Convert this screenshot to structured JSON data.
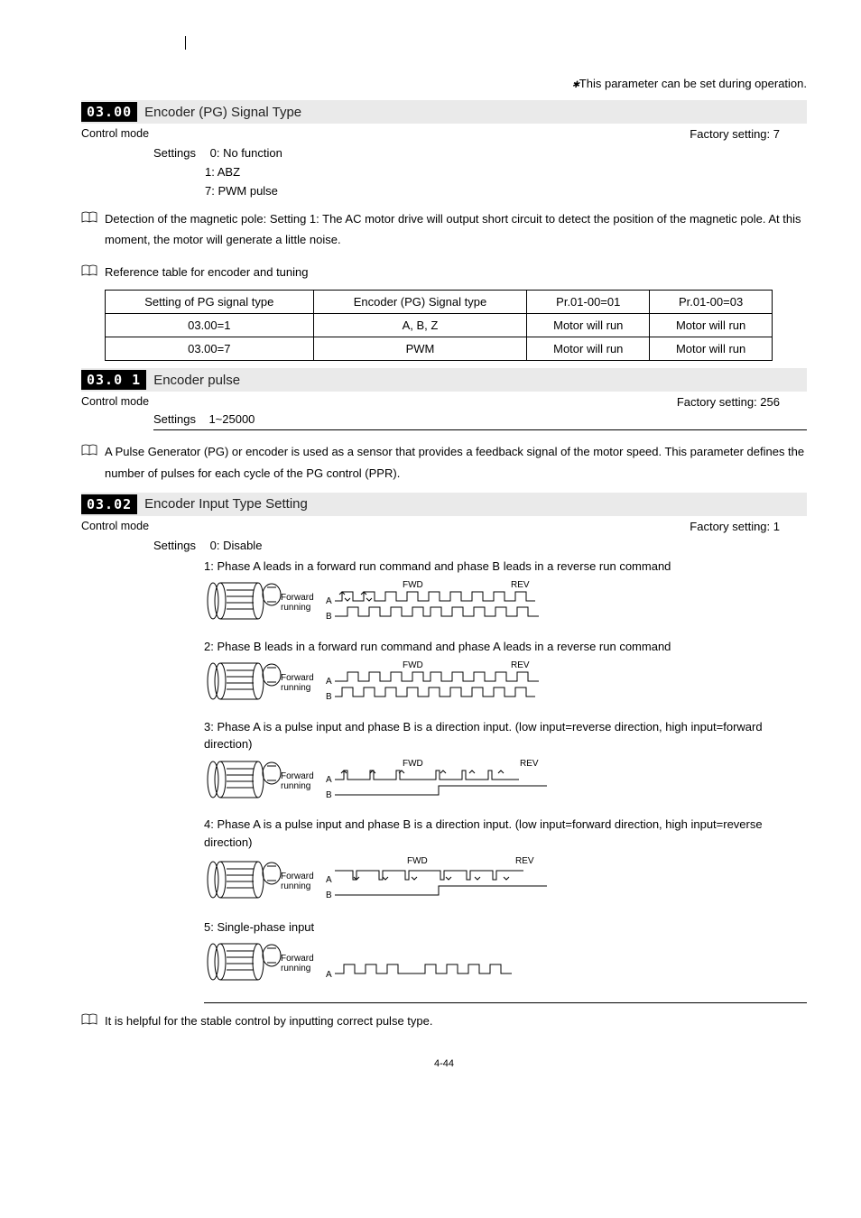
{
  "header": {
    "notice_prefix": "✱",
    "notice_text": "This parameter can be set during operation."
  },
  "params": {
    "p0300": {
      "code": "03.00",
      "title": "Encoder (PG) Signal Type",
      "control_mode": "Control mode",
      "factory": "Factory setting: 7",
      "settings_label": "Settings",
      "settings": [
        "0: No function",
        "1: ABZ",
        "7: PWM pulse"
      ]
    },
    "p0301": {
      "code": "03.01",
      "code_display": "03.0 1",
      "title": "Encoder pulse",
      "control_mode": "Control mode",
      "factory": "Factory setting: 256",
      "settings_label": "Settings",
      "settings_range": "1~25000"
    },
    "p0302": {
      "code": "03.02",
      "title": "Encoder Input Type Setting",
      "control_mode": "Control mode",
      "factory": "Factory setting: 1",
      "settings_label": "Settings",
      "opt0": "0: Disable",
      "opt1": "1: Phase A leads in a forward run command and phase B leads in a reverse run command",
      "opt2": "2: Phase B leads in a forward run command and phase A leads in a reverse run command",
      "opt3": "3: Phase A is a pulse input and phase B is a direction input. (low input=reverse direction, high input=forward direction)",
      "opt4": "4: Phase A is a pulse input and phase B is a direction input. (low input=forward direction, high input=reverse direction)",
      "opt5": "5: Single-phase input"
    }
  },
  "notes": {
    "n1": "Detection of the magnetic pole: Setting 1: The AC motor drive will output short circuit to detect the position of the magnetic pole. At this moment, the motor will generate a little noise.",
    "n2": "Reference table for encoder and tuning",
    "n3": "A Pulse Generator (PG) or encoder is used as a sensor that provides a feedback signal of the motor speed. This parameter defines the number of pulses for each cycle of the PG control (PPR).",
    "n4": "It is helpful for the stable control by inputting correct pulse type."
  },
  "ref_table": {
    "headers": [
      "Setting of PG signal type",
      "Encoder (PG) Signal type",
      "Pr.01-00=01",
      "Pr.01-00=03"
    ],
    "rows": [
      [
        "03.00=1",
        "A, B, Z",
        "Motor will run",
        "Motor will run"
      ],
      [
        "03.00=7",
        "PWM",
        "Motor will run",
        "Motor will run"
      ]
    ]
  },
  "diagram_labels": {
    "fwd": "FWD",
    "rev": "REV",
    "forward": "Forward",
    "running": "running",
    "a": "A",
    "b": "B"
  },
  "page_num": "4-44"
}
